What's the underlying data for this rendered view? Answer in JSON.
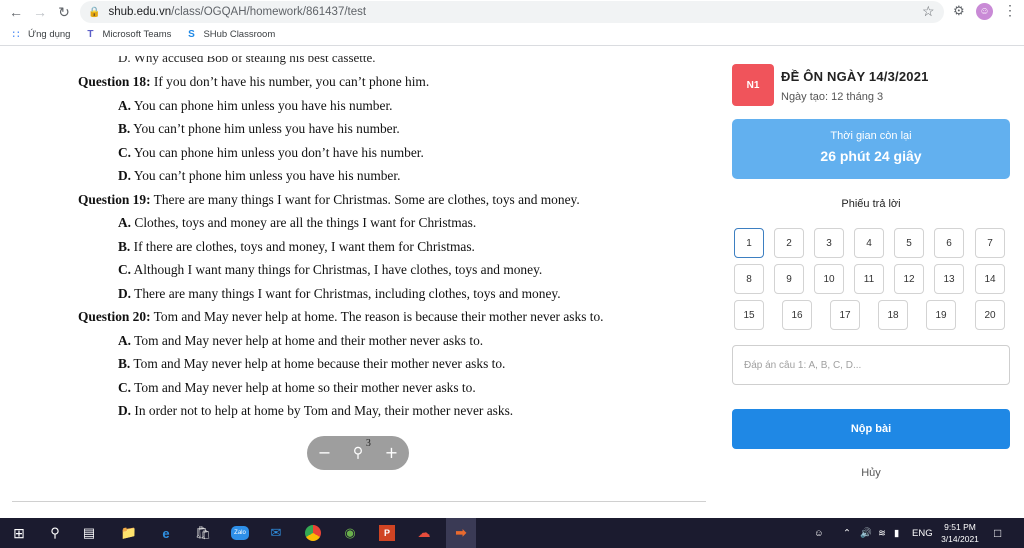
{
  "browser": {
    "url_host": "shub.edu.vn",
    "url_path": "/class/OGQAH/homework/861437/test",
    "bookmarks": [
      {
        "label": "Ứng dụng",
        "icon": "apps-grid-icon"
      },
      {
        "label": "Microsoft Teams",
        "icon": "teams-icon"
      },
      {
        "label": "SHub Classroom",
        "icon": "shub-icon"
      }
    ]
  },
  "document": {
    "cut_line": "D. Why accused Bob of stealing his best cassette.",
    "questions": [
      {
        "label": "Question 18:",
        "text": "If you don’t have his number, you can’t phone him.",
        "options": [
          {
            "letter": "A.",
            "text": "You can phone him unless you have his number."
          },
          {
            "letter": "B.",
            "text": "You can’t phone him unless you have his number."
          },
          {
            "letter": "C.",
            "text": "You can phone him unless you don’t have his number."
          },
          {
            "letter": "D.",
            "text": "You can’t phone him unless you have his number."
          }
        ]
      },
      {
        "label": "Question 19:",
        "text": "There are many things I want for Christmas. Some are clothes, toys and money.",
        "options": [
          {
            "letter": "A.",
            "text": "Clothes, toys and money are all the things I want for Christmas."
          },
          {
            "letter": "B.",
            "text": "If there are clothes, toys and money, I want them for Christmas."
          },
          {
            "letter": "C.",
            "text": "Although I want many things for Christmas, I have clothes, toys and money."
          },
          {
            "letter": "D.",
            "text": "There are many things I want for Christmas, including clothes, toys and money."
          }
        ]
      },
      {
        "label": "Question 20:",
        "text": "Tom and May never help at home. The reason is because their mother never asks to.",
        "options": [
          {
            "letter": "A.",
            "text": "Tom and May never help at home and their mother never asks to."
          },
          {
            "letter": "B.",
            "text": "Tom and May never help at home because their mother never asks to."
          },
          {
            "letter": "C.",
            "text": "Tom and May never help at home so their mother never asks to."
          },
          {
            "letter": "D.",
            "text": "In order not to help at home by Tom and May, their mother never asks."
          }
        ]
      }
    ],
    "zoom": {
      "minus": "−",
      "plus": "+",
      "page": "3"
    }
  },
  "panel": {
    "badge": "N1",
    "title": "ĐỀ ÔN NGÀY 14/3/2021",
    "created": "Ngày tạo: 12 tháng 3",
    "timer_label": "Thời gian còn lại",
    "timer_value": "26 phút 24 giây",
    "sheet_title": "Phiếu trả lời",
    "answer_numbers": [
      "1",
      "2",
      "3",
      "4",
      "5",
      "6",
      "7",
      "8",
      "9",
      "10",
      "11",
      "12",
      "13",
      "14",
      "15",
      "16",
      "17",
      "18",
      "19",
      "20"
    ],
    "active_question": "1",
    "answer_placeholder": "Đáp án câu 1: A, B, C, D...",
    "submit_label": "Nộp bài",
    "cancel_label": "Hủy",
    "colors": {
      "badge": "#f0545b",
      "timer": "#62b0ef",
      "submit": "#1f88e5"
    }
  },
  "taskbar": {
    "language": "ENG",
    "time": "9:51 PM",
    "date": "3/14/2021"
  }
}
